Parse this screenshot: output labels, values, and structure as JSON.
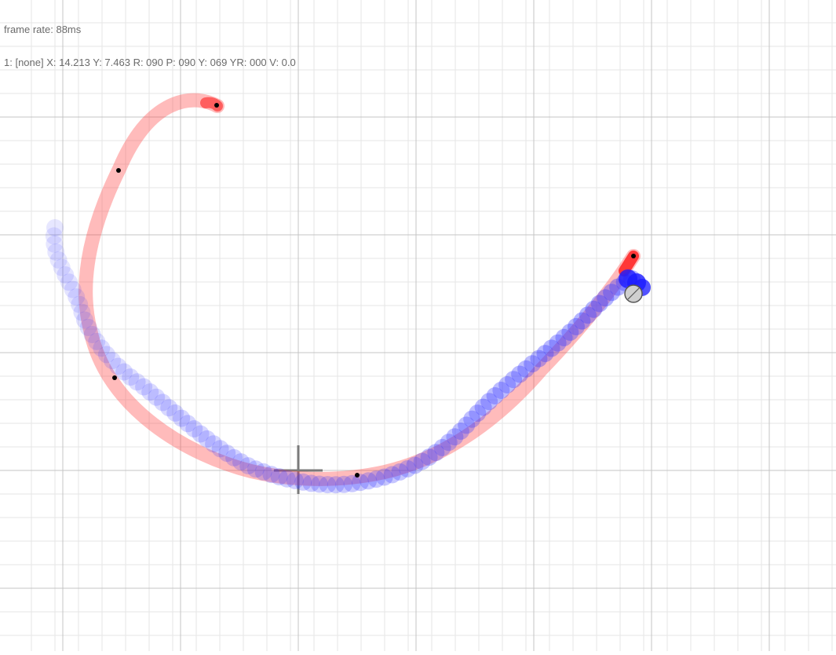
{
  "hud": {
    "frame_rate": "frame rate: 88ms",
    "pointer_status": "1: [none] X: 14.213 Y: 7.463 R: 090 P: 090 Y: 069 YR: 000 V: 0.0"
  },
  "colors": {
    "background": "#ffffff",
    "grid_minor": "#e6e6e6",
    "grid_major": "#c4c4c4",
    "crosshair": "#7a7a7a",
    "red_trail": "#ff3b3b",
    "blue_trail": "#3b3bff",
    "sample_dot": "#000000",
    "cursor_fill": "#cfcfcf",
    "cursor_stroke": "#555555"
  },
  "icons": {
    "origin": "crosshair-icon",
    "pointer": "pointer-cursor-icon"
  }
}
